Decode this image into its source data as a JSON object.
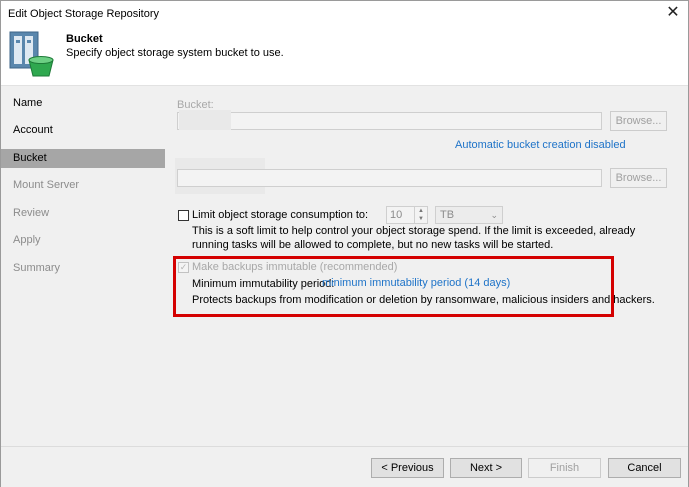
{
  "window": {
    "title": "Edit Object Storage Repository",
    "close_glyph": "✕"
  },
  "header": {
    "title": "Bucket",
    "subtitle": "Specify object storage system bucket to use."
  },
  "sidebar": {
    "items": [
      {
        "label": "Name",
        "state": "enabled"
      },
      {
        "label": "Account",
        "state": "enabled"
      },
      {
        "label": "Bucket",
        "state": "active"
      },
      {
        "label": "Mount Server",
        "state": "disabled"
      },
      {
        "label": "Review",
        "state": "disabled"
      },
      {
        "label": "Apply",
        "state": "disabled"
      },
      {
        "label": "Summary",
        "state": "disabled"
      }
    ]
  },
  "bucket": {
    "label": "Bucket:",
    "browse_label": "Browse...",
    "auto_creation_link": "Automatic bucket creation disabled"
  },
  "folder": {
    "browse_label": "Browse..."
  },
  "limit": {
    "checkbox_label": "Limit object storage consumption to:",
    "value": "10",
    "unit": "TB",
    "description": "This is a soft limit to help control your object storage spend. If the limit is exceeded, already running tasks will be allowed to complete, but no new tasks will be started."
  },
  "immutable": {
    "checkbox_label": "Make backups immutable (recommended)",
    "checked": true,
    "period_label": "Minimum immutability period:",
    "period_link": "minimum immutability period (14 days)",
    "description": "Protects backups from modification or deletion by ransomware, malicious insiders and hackers."
  },
  "footer": {
    "previous_label": "< Previous",
    "next_label": "Next >",
    "finish_label": "Finish",
    "cancel_label": "Cancel"
  },
  "colors": {
    "highlight_border": "#d40000",
    "link": "#1e73c8",
    "sidebar_active": "#a6a6a6"
  },
  "icons": {
    "app": "object-storage-bucket-icon"
  }
}
